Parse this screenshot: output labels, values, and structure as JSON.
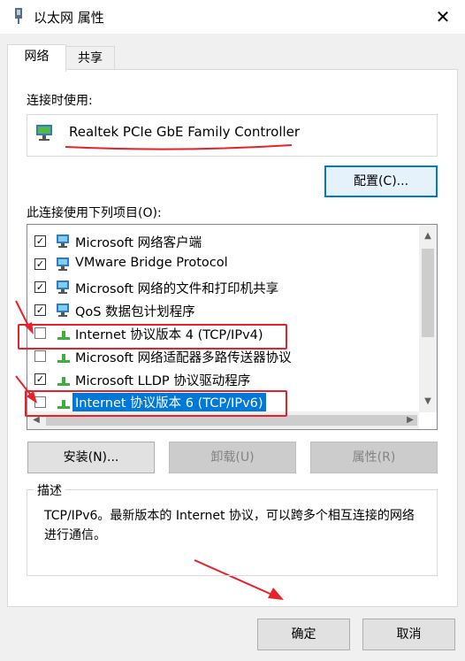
{
  "window": {
    "title": "以太网 属性",
    "close_glyph": "✕"
  },
  "tabs": [
    {
      "label": "网络",
      "active": true
    },
    {
      "label": "共享",
      "active": false
    }
  ],
  "connect_using": {
    "label": "连接时使用:",
    "adapter_name": "Realtek PCIe GbE Family Controller",
    "configure_button": "配置(C)..."
  },
  "items_section": {
    "label": "此连接使用下列项目(O):",
    "items": [
      {
        "label": "Microsoft 网络客户端",
        "checked": true,
        "icon": "network-client-icon"
      },
      {
        "label": "VMware Bridge Protocol",
        "checked": true,
        "icon": "network-service-icon"
      },
      {
        "label": "Microsoft 网络的文件和打印机共享",
        "checked": true,
        "icon": "network-service-icon"
      },
      {
        "label": "QoS 数据包计划程序",
        "checked": true,
        "icon": "network-service-icon"
      },
      {
        "label": "Internet 协议版本 4 (TCP/IPv4)",
        "checked": false,
        "icon": "protocol-icon"
      },
      {
        "label": "Microsoft 网络适配器多路传送器协议",
        "checked": false,
        "icon": "protocol-icon"
      },
      {
        "label": "Microsoft LLDP 协议驱动程序",
        "checked": true,
        "icon": "protocol-icon"
      },
      {
        "label": "Internet 协议版本 6 (TCP/IPv6)",
        "checked": false,
        "icon": "protocol-icon",
        "selected": true
      }
    ]
  },
  "actions": {
    "install": "安装(N)...",
    "uninstall": "卸载(U)",
    "properties": "属性(R)"
  },
  "description": {
    "title": "描述",
    "text": "TCP/IPv6。最新版本的 Internet 协议，可以跨多个相互连接的网络进行通信。"
  },
  "footer": {
    "ok": "确定",
    "cancel": "取消"
  },
  "colors": {
    "accent": "#0078d7",
    "annotation_red": "#e8202a"
  }
}
